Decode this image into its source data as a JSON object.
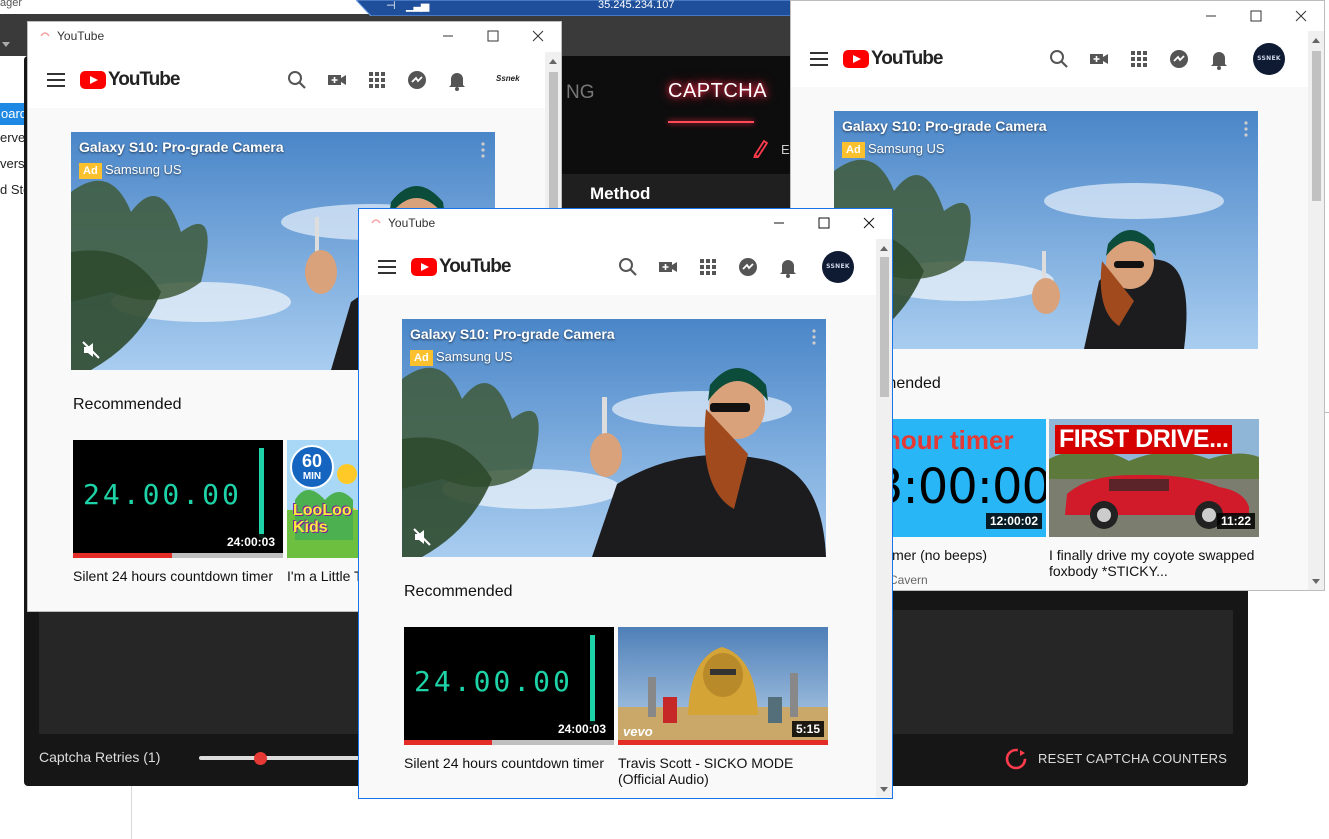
{
  "background_app": {
    "topbar_title": "ager",
    "left_items": [
      "oard",
      "erve",
      "vers",
      "d Sto"
    ],
    "tab_faded": "NG",
    "tab_active": "CAPTCHA",
    "edit_partial": "E",
    "method_label": "Method",
    "captcha_retries": "Captcha Retries (1)",
    "slider_level": 0.38,
    "reset_label": "RESET CAPTCHA COUNTERS",
    "accent_color": "#ff2a4a"
  },
  "remote_session": {
    "ip": "35.245.234.107"
  },
  "window_left": {
    "title": "YouTube",
    "logo_text": "YouTube",
    "avatar_text": "Ssnek",
    "ad": {
      "title": "Galaxy S10: Pro-grade Camera",
      "badge": "Ad",
      "sponsor": "Samsung US"
    },
    "recommended_label": "Recommended",
    "videos": [
      {
        "title": "Silent 24 hours countdown timer",
        "duration": "24:00:03",
        "timer_text": "24.00.00",
        "progress": 0.47
      },
      {
        "title": "I'm a Little T... English with",
        "badge_60": "60",
        "badge_min": "MIN",
        "brand": "LooLoo Kids"
      }
    ]
  },
  "window_center": {
    "title": "YouTube",
    "logo_text": "YouTube",
    "avatar_text": "SSNEK",
    "ad": {
      "title": "Galaxy S10: Pro-grade Camera",
      "badge": "Ad",
      "sponsor": "Samsung US"
    },
    "recommended_label": "Recommended",
    "videos": [
      {
        "title": "Silent 24 hours countdown timer",
        "duration": "24:00:03",
        "timer_text": "24.00.00",
        "progress": 0.42
      },
      {
        "title": "Travis Scott - SICKO MODE (Official Audio)",
        "duration": "5:15",
        "brand": "vevo",
        "progress": 1.0
      }
    ]
  },
  "window_right": {
    "logo_text": "YouTube",
    "avatar_text": "SSNEK",
    "ad": {
      "title": "Galaxy S10: Pro-grade Camera",
      "badge": "Ad",
      "sponsor": "Samsung US"
    },
    "recommended_partial": "mended",
    "videos": [
      {
        "title": "imer (no beeps)",
        "channel": "Cavern",
        "duration": "12:00:02",
        "thumb_line1": "hour timer",
        "thumb_line2": "3:00:00"
      },
      {
        "title": "I finally drive my coyote swapped foxbody *STICKY...",
        "duration": "11:22",
        "thumb_caption": "FIRST DRIVE..."
      }
    ]
  }
}
